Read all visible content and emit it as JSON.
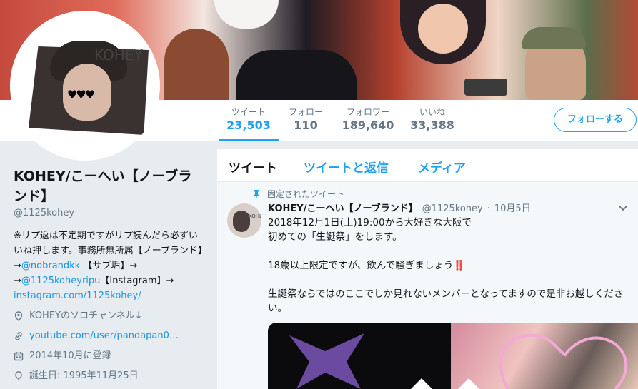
{
  "profile": {
    "display_name": "KOHEY/こーへい【ノーブランド】",
    "handle": "@1125kohey",
    "avatar_text": "KOHEY",
    "bio_line1": "※リプ返は不定期ですがリプ読んだら必ずいいね押します。事務所無所属【ノーブランド】→",
    "bio_link1": "@nobrandkk",
    "bio_line2": " 【サブ垢】→",
    "bio_link2": "@1125koheyripu",
    "bio_line3": "【Instagram】→",
    "bio_link3": "instagram.com/1125kohey/",
    "location": "KOHEYのソロチャンネル↓",
    "url": "youtube.com/user/pandapan0…",
    "joined": "2014年10月に登録",
    "birthday": "誕生日: 1995年11月25日"
  },
  "stats": [
    {
      "label": "ツイート",
      "value": "23,503"
    },
    {
      "label": "フォロー",
      "value": "110"
    },
    {
      "label": "フォロワー",
      "value": "189,640"
    },
    {
      "label": "いいね",
      "value": "33,388"
    }
  ],
  "follow_button": "フォローする",
  "tabs": [
    "ツイート",
    "ツイートと返信",
    "メディア"
  ],
  "tweet": {
    "pinned_label": "固定されたツイート",
    "avatar_text": "KOHEY",
    "name": "KOHEY/こーへい【ノーブランド】",
    "handle": "@1125kohey",
    "separator": "·",
    "date": "10月5日",
    "text": "2018年12月1日(土)19:00から大好きな大阪で\n初めての「生誕祭」をします。\n\n18歳以上限定ですが、飲んで騒ぎましょう‼️\n\n生誕祭ならではのここでしか見れないメンバーとなってますので是非お越しください。"
  },
  "colors": {
    "accent": "#1da1f2",
    "link": "#1b95e0",
    "muted": "#657786",
    "background": "#e6ecf0"
  },
  "icons": [
    "location-icon",
    "link-icon",
    "calendar-icon",
    "balloon-icon",
    "pin-icon",
    "chevron-down-icon"
  ]
}
